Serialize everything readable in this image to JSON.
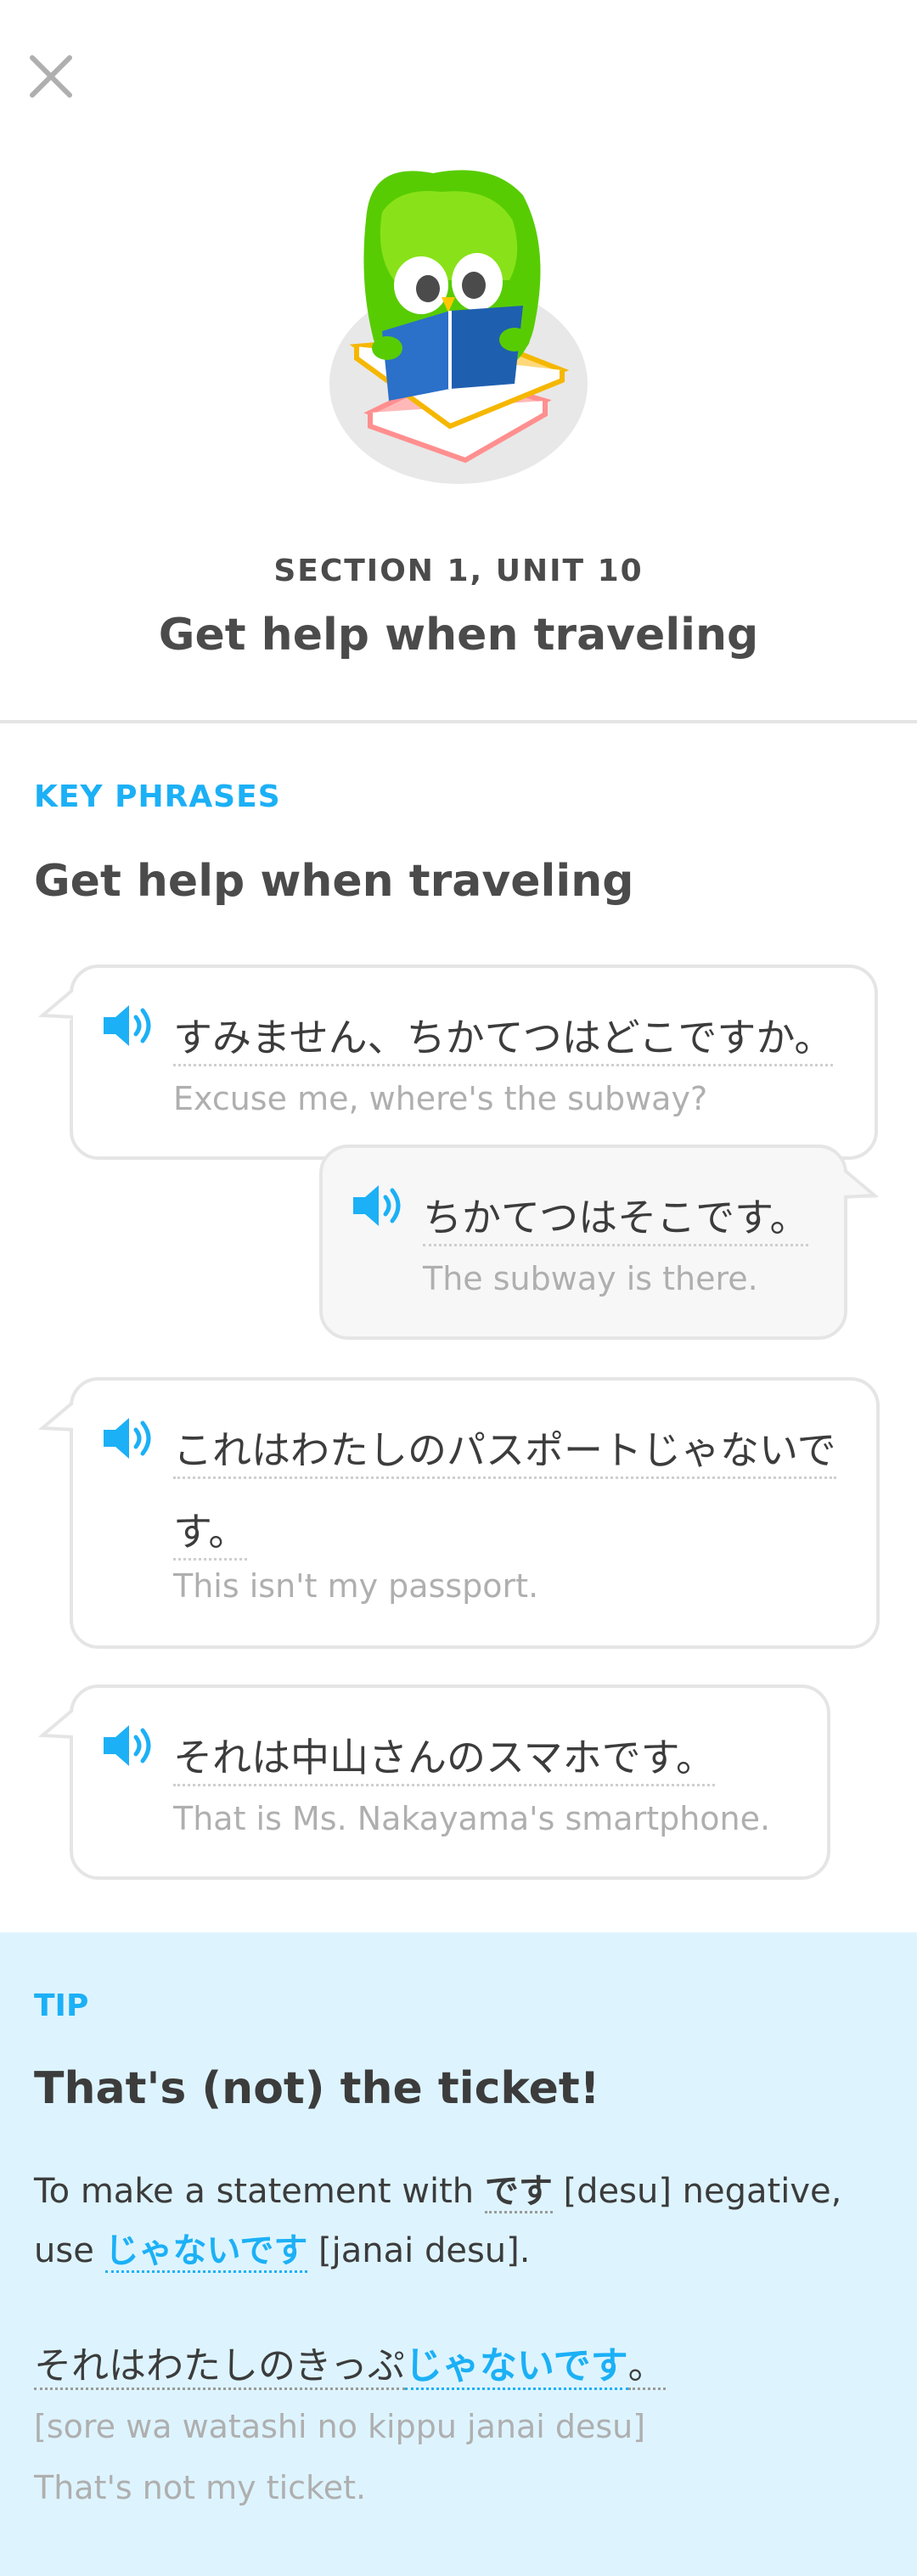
{
  "header": {
    "section_label": "SECTION 1, UNIT 10",
    "unit_title": "Get help when traveling"
  },
  "key_phrases": {
    "label": "KEY PHRASES",
    "title": "Get help when traveling",
    "phrases": [
      {
        "jp": "すみません、ちかてつはどこですか。",
        "en": "Excuse me, where's the subway?"
      },
      {
        "jp": "ちかてつはそこです。",
        "en": "The subway is there."
      },
      {
        "jp": "これはわたしのパスポートじゃないです。",
        "en": "This isn't my passport."
      },
      {
        "jp": "それは中山さんのスマホです。",
        "en": "That is Ms. Nakayama's smartphone."
      }
    ]
  },
  "tip": {
    "label": "TIP",
    "title": "That's (not) the ticket!",
    "body_1": "To make a statement with ",
    "keyword_desu": "です",
    "body_2": " [desu] negative, use ",
    "keyword_janai": "じゃないです",
    "body_3": " [janai desu].",
    "example_jp_base": "それはわたしのきっぷ",
    "example_jp_highlight": "じゃないです",
    "example_jp_end": "。",
    "example_romaji": "[sore wa watashi no kippu janai desu]",
    "example_en": "That's not my ticket."
  },
  "colors": {
    "accent": "#1cb0f6",
    "tip_background": "#ddf4ff",
    "mascot_green": "#58cc02",
    "book_blue": "#2b70c9"
  },
  "icons": [
    "close-icon",
    "speaker-icon",
    "owl-mascot"
  ]
}
